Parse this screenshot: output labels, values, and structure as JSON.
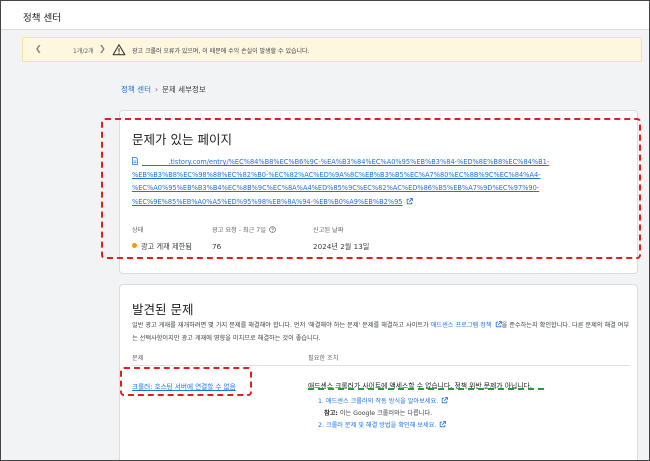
{
  "app": {
    "title": "정책 센터"
  },
  "banner": {
    "pager": "1개/2개",
    "message": "광고 크롤러 오류가 있으며, 이 때문에 수익 손실이 발생할 수 있습니다."
  },
  "breadcrumb": {
    "root": "정책 센터",
    "current": "문제 세부정보"
  },
  "problem_page": {
    "title": "문제가 있는 페이지",
    "url_lines": [
      "________.tistory.com/entry/%EC%84%B8%EC%B6%9C-%EA%B3%84%EC%A0%95%EB%B3%84-%ED%8E%B8%EC%84%B1-",
      "%EB%B3%B8%EC%98%88%EC%82%B0-%EC%82%AC%ED%9A%8C%EB%B3%B5%EC%A7%80%EC%8B%9C%EC%84%A4-",
      "%EC%A0%95%EB%B3%B4%EC%8B%9C%EC%8A%A4%ED%85%9C%EC%82%AC%ED%86%B5%EB%A7%9D%EC%97%90-",
      "%EC%9E%85%EB%A0%A5%ED%95%98%EB%8A%94-%EB%B0%A9%EB%B2%95"
    ],
    "status_label": "상태",
    "status_value": "광고 게재 제한됨",
    "requests_label": "광고 요청 - 최근 7일",
    "requests_value": "76",
    "date_label": "신고된 날짜",
    "date_value": "2024년 2월 13일"
  },
  "found_issues": {
    "title": "발견된 문제",
    "desc_part1": "일반 광고 게재를 재개하려면 몇 가지 문제를 해결해야 합니다. 먼저 '해결해야 하는 문제' 문제를 해결하고 사이트가 ",
    "desc_link": "애드센스 프로그램 정책",
    "desc_part2": "을 준수하는지 확인합니다. 다른 문제의 해결 여부는 선택사항이지만 광고 게재에 영향을 미치므로 해결하는 것이 좋습니다.",
    "col_issue": "문제",
    "col_action": "필요한 조치",
    "issue": "크롤러: 호스팅 서버에 연결할 수 없음",
    "action_main": "애드센스 크롤러가 사이트에 액세스할 수 없습니다. 정책 위반 문제가 아닙니다.",
    "step1": "1. 애드센스 크롤러의 작동 방식을 알아보세요.",
    "note_label": "참고:",
    "note_text": " 이는 Google 크롤러와는 다릅니다.",
    "step2": "2. 크롤러 문제 및 해결 방법을 확인해 보세요."
  },
  "colors": {
    "accent": "#1a73e8",
    "warning": "#f29900",
    "highlight_red": "#e0201b",
    "highlight_green": "#1e9e3a"
  }
}
